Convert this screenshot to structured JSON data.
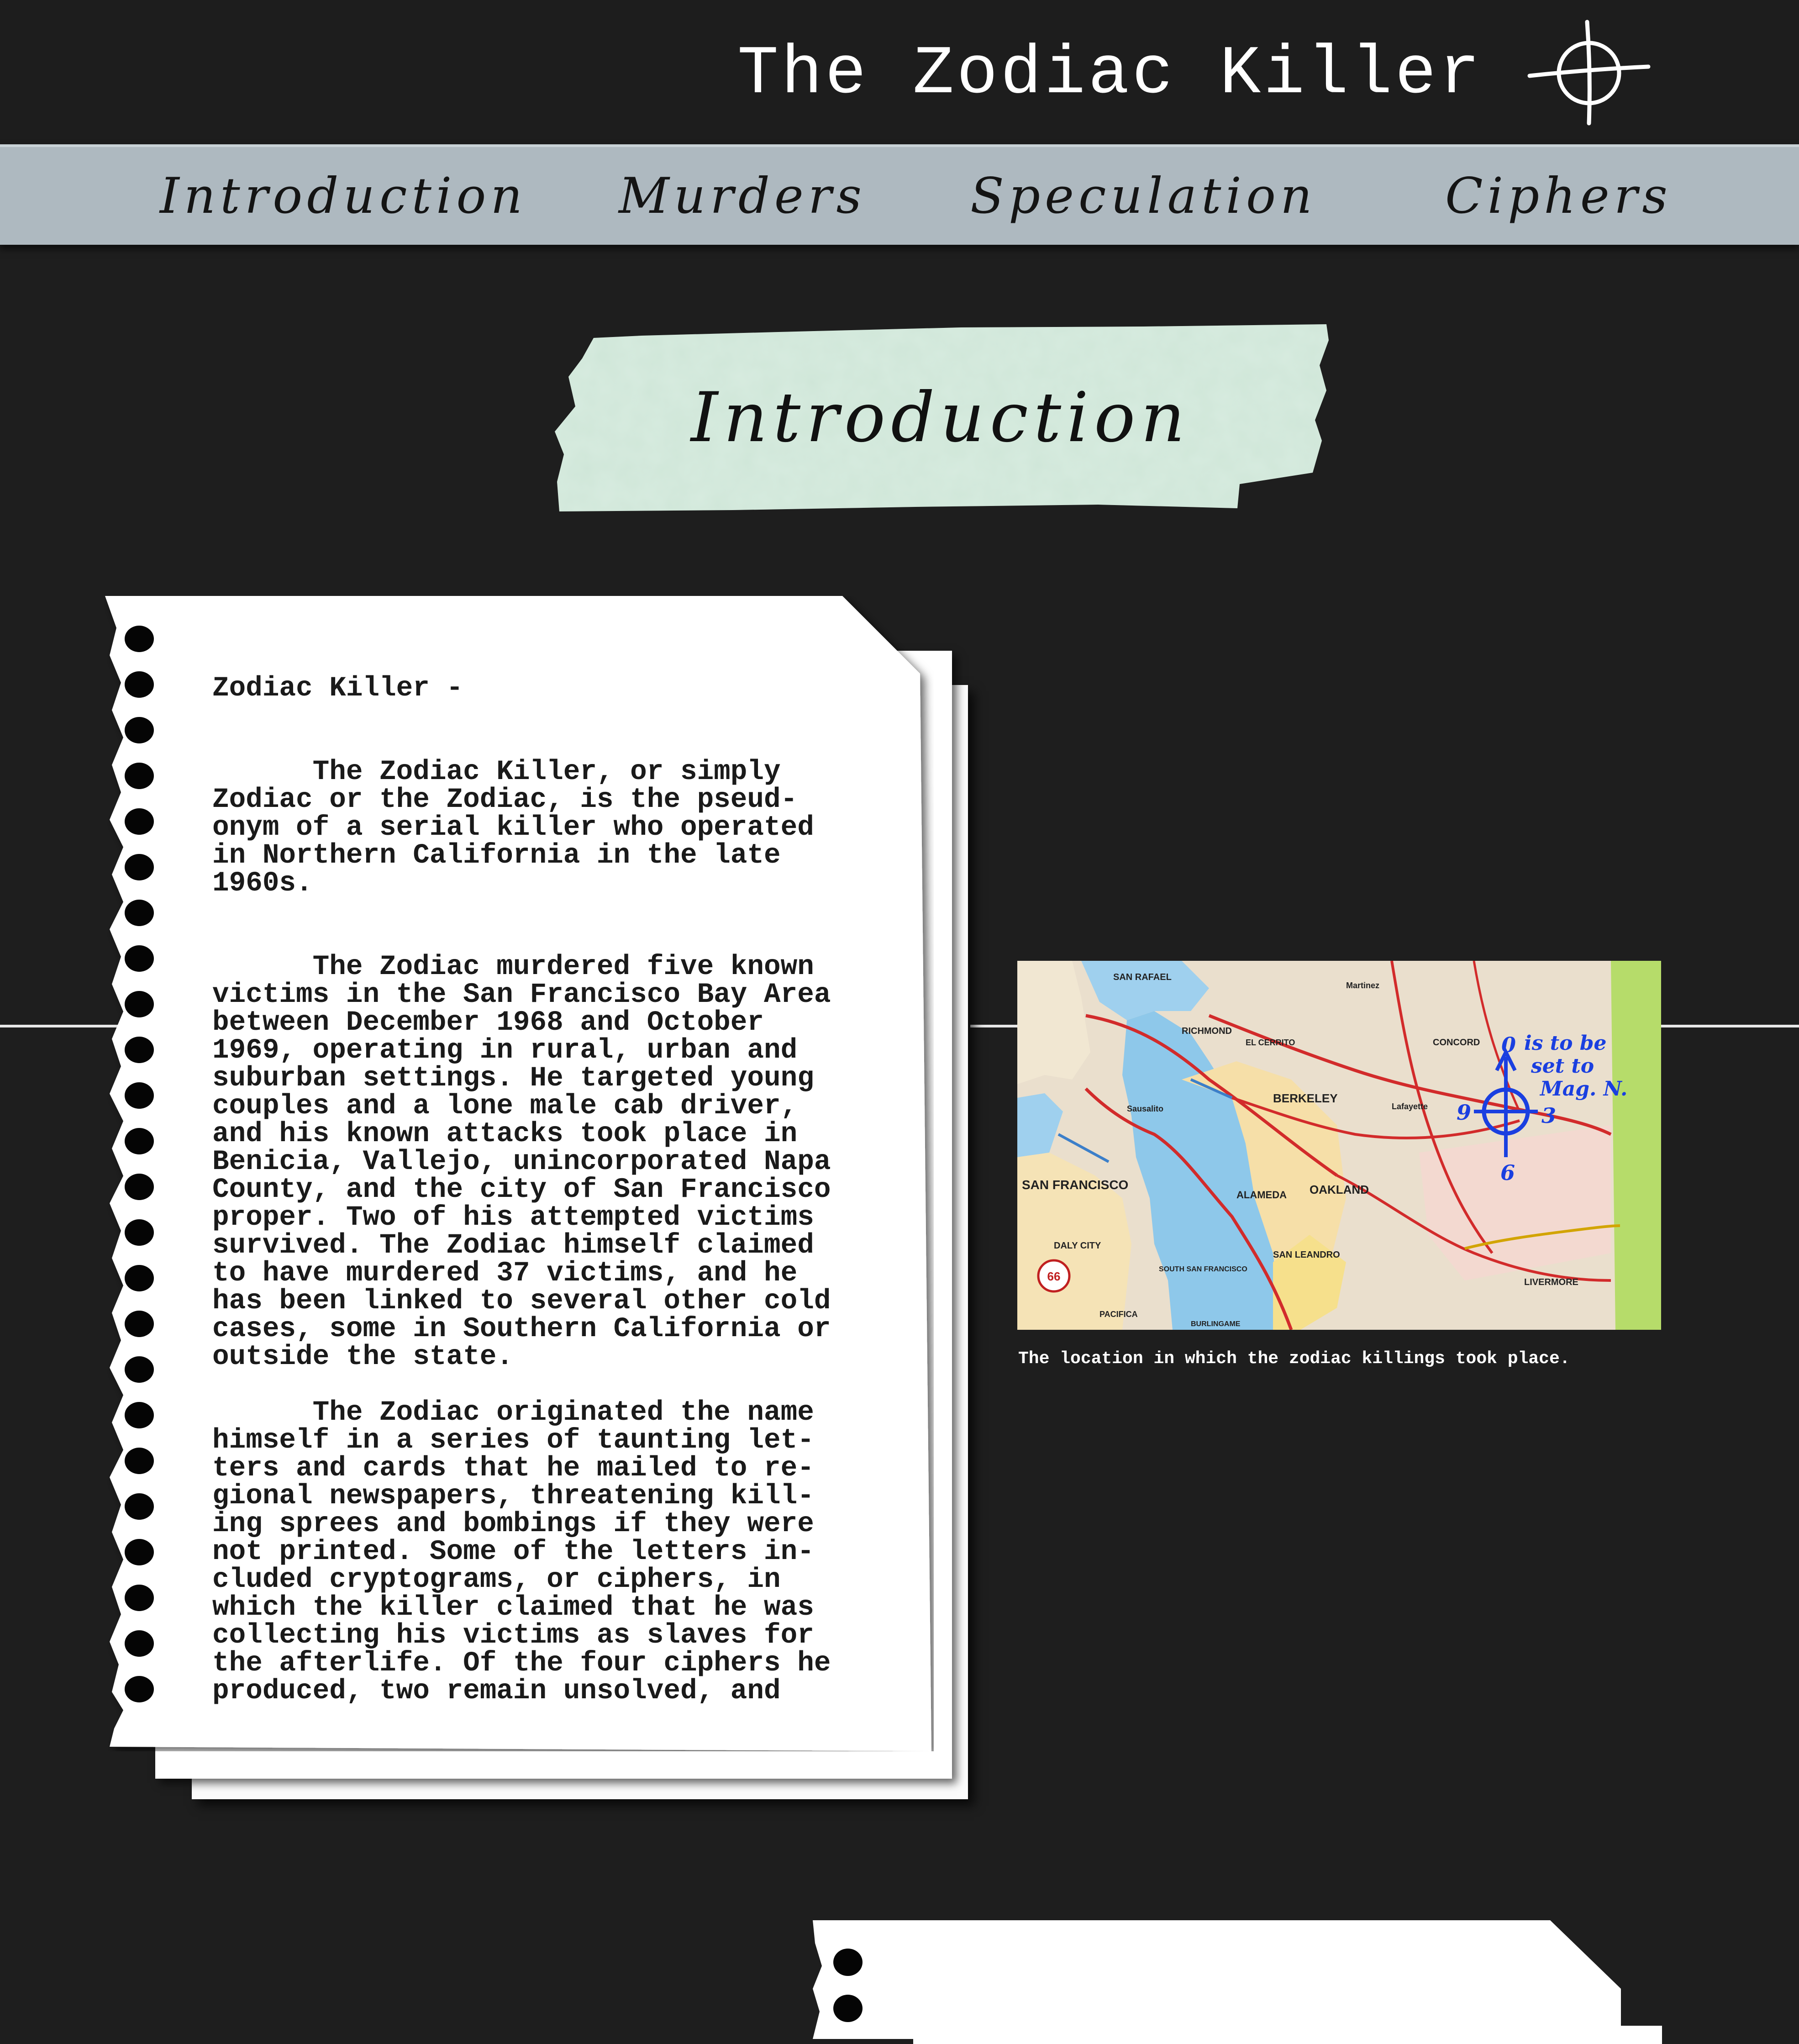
{
  "header": {
    "title": "The Zodiac Killer",
    "logo_icon": "crosshair-icon"
  },
  "nav": {
    "items": [
      {
        "label": "Introduction"
      },
      {
        "label": "Murders"
      },
      {
        "label": "Speculation"
      },
      {
        "label": "Ciphers"
      }
    ]
  },
  "section": {
    "title": "Introduction"
  },
  "paper": {
    "text": "Zodiac Killer -\n\n\n      The Zodiac Killer, or simply\nZodiac or the Zodiac, is the pseud-\nonym of a serial killer who operated\nin Northern California in the late\n1960s.\n\n\n      The Zodiac murdered five known\nvictims in the San Francisco Bay Area\nbetween December 1968 and October\n1969, operating in rural, urban and\nsuburban settings. He targeted young\ncouples and a lone male cab driver,\nand his known attacks took place in\nBenicia, Vallejo, unincorporated Napa\nCounty, and the city of San Francisco\nproper. Two of his attempted victims\nsurvived. The Zodiac himself claimed\nto have murdered 37 victims, and he\nhas been linked to several other cold\ncases, some in Southern California or\noutside the state.\n\n      The Zodiac originated the name\nhimself in a series of taunting let-\nters and cards that he mailed to re-\ngional newspapers, threatening kill-\ning sprees and bombings if they were\nnot printed. Some of the letters in-\ncluded cryptograms, or ciphers, in\nwhich the killer claimed that he was\ncollecting his victims as slaves for\nthe afterlife. Of the four ciphers he\nproduced, two remain unsolved, and"
  },
  "map": {
    "labels": {
      "san_rafael": "SAN RAFAEL",
      "richmond": "RICHMOND",
      "el_cerrito": "EL CERRITO",
      "berkeley": "BERKELEY",
      "concord": "CONCORD",
      "oakland": "OAKLAND",
      "alameda": "ALAMEDA",
      "san_francisco": "SAN FRANCISCO",
      "daly_city": "DALY CITY",
      "south_sf": "SOUTH SAN FRANCISCO",
      "san_leandro": "SAN LEANDRO",
      "livermore": "LIVERMORE",
      "pacifica": "PACIFICA",
      "burlingame": "BURLINGAME",
      "lafayette": "Lafayette",
      "sausalito": "Sausalito",
      "martinez": "Martinez"
    },
    "annotation": {
      "n0": "0",
      "n3": "3",
      "n6": "6",
      "n9": "9",
      "note1": "is to be",
      "note2": "set to",
      "note3": "Mag. N."
    },
    "caption": "The location in which the zodiac killings took place."
  },
  "colors": {
    "background": "#1e1e1e",
    "nav": "#aeb9c0",
    "tape": "#cfe6d8",
    "annotation_blue": "#1a3fe0"
  }
}
